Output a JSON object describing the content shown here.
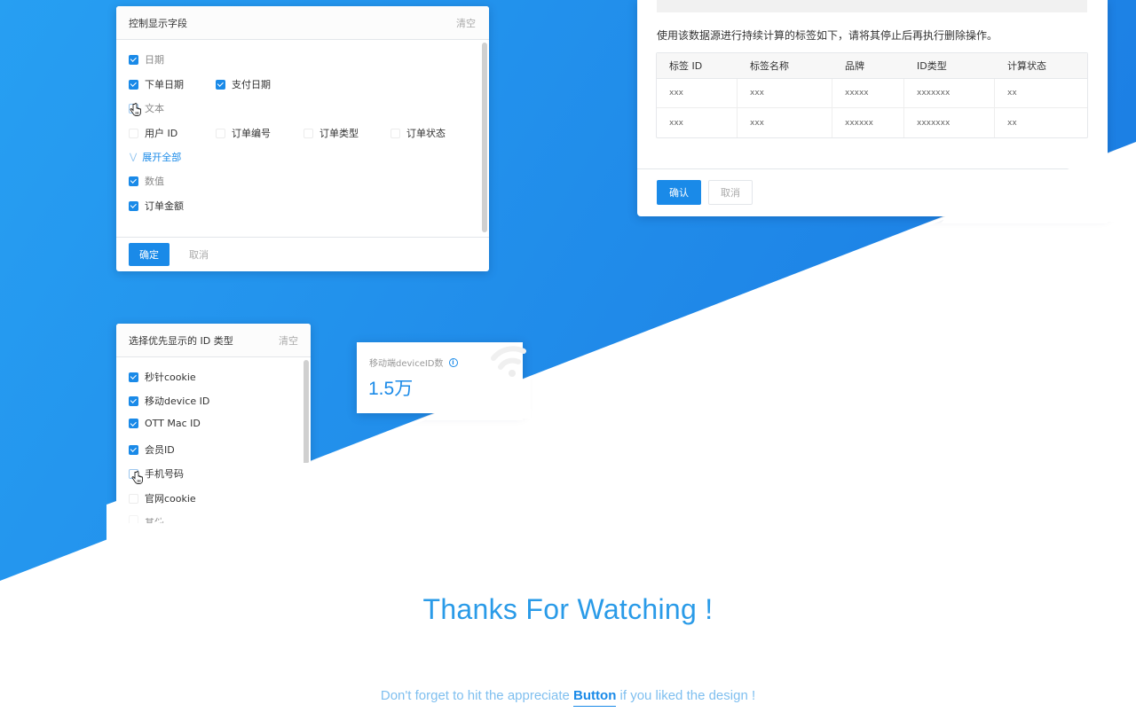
{
  "colors": {
    "accent": "#1a8ae8",
    "bg_blue_light": "#279ff2",
    "bg_blue_dark": "#1c84e6",
    "thanks_text": "#2a9be8"
  },
  "fields_panel": {
    "title": "控制显示字段",
    "clear_label": "清空",
    "groups": [
      {
        "label": "日期",
        "checked": true,
        "items": [
          {
            "label": "下单日期",
            "checked": true
          },
          {
            "label": "支付日期",
            "checked": true
          }
        ]
      },
      {
        "label": "文本",
        "checked": false,
        "items": [
          {
            "label": "用户 ID",
            "checked": false
          },
          {
            "label": "订单编号",
            "checked": false
          },
          {
            "label": "订单类型",
            "checked": false
          },
          {
            "label": "订单状态",
            "checked": false
          }
        ]
      },
      {
        "label": "数值",
        "checked": true,
        "items": [
          {
            "label": "订单金额",
            "checked": true
          }
        ]
      }
    ],
    "expand_label": "展开全部",
    "expand_icon": "double-chevron-down-icon",
    "confirm_label": "确定",
    "cancel_label": "取消"
  },
  "delete_dialog": {
    "message": "使用该数据源进行持续计算的标签如下，请将其停止后再执行删除操作。",
    "table": {
      "columns": [
        "标签 ID",
        "标签名称",
        "品牌",
        "ID类型",
        "计算状态"
      ],
      "rows": [
        [
          "xxx",
          "xxx",
          "xxxxx",
          "xxxxxxx",
          "xx"
        ],
        [
          "xxx",
          "xxx",
          "xxxxxx",
          "xxxxxxx",
          "xx"
        ]
      ]
    },
    "confirm_label": "确认",
    "cancel_label": "取消"
  },
  "id_panel": {
    "title": "选择优先显示的 ID 类型",
    "clear_label": "清空",
    "items": [
      {
        "label": "秒针cookie",
        "checked": true
      },
      {
        "label": "移动device ID",
        "checked": true
      },
      {
        "label": "OTT Mac ID",
        "checked": true
      },
      {
        "label": "会员ID",
        "checked": true
      },
      {
        "label": "手机号码",
        "checked": false
      },
      {
        "label": "官网cookie",
        "checked": false
      },
      {
        "label": "其他",
        "checked": false
      }
    ]
  },
  "metric_card": {
    "label": "移动端deviceID数",
    "info_icon": "info-icon",
    "value": "1.5万",
    "watermark_icon": "wifi-signal-icon"
  },
  "footer": {
    "title": "Thanks For Watching !",
    "line_before": "Don't forget to hit the appreciate ",
    "link_label": "Button",
    "line_after": " if you liked the design !"
  }
}
